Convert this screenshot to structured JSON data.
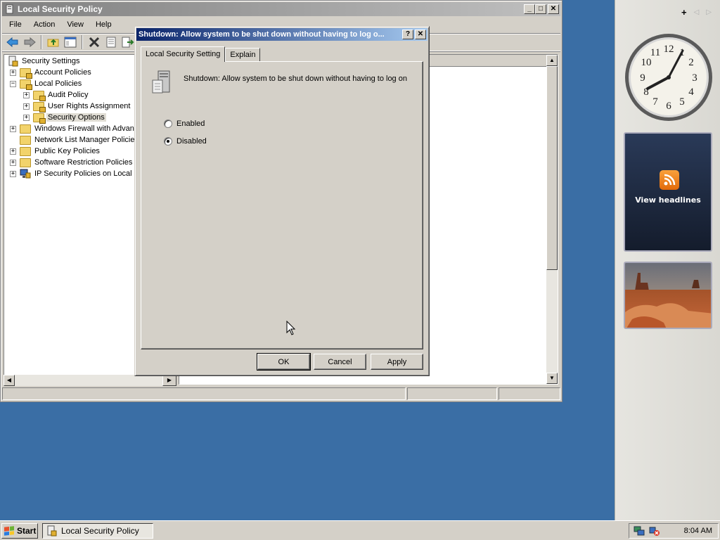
{
  "main_window": {
    "title": "Local Security Policy",
    "caption_buttons": {
      "minimize": "_",
      "maximize": "□",
      "close": "✕"
    },
    "menu": [
      "File",
      "Action",
      "View",
      "Help"
    ],
    "toolbar_icons": [
      "back-icon",
      "forward-icon",
      "up-folder-icon",
      "show-hide-tree-icon",
      "delete-icon",
      "properties-icon",
      "export-list-icon"
    ],
    "tree": {
      "root": "Security Settings",
      "items": [
        {
          "label": "Account Policies",
          "level": 1,
          "expander": "+"
        },
        {
          "label": "Local Policies",
          "level": 1,
          "expander": "−"
        },
        {
          "label": "Audit Policy",
          "level": 2,
          "expander": "+"
        },
        {
          "label": "User Rights Assignment",
          "level": 2,
          "expander": "+"
        },
        {
          "label": "Security Options",
          "level": 2,
          "expander": "+",
          "selected": true
        },
        {
          "label": "Windows Firewall with Advanc",
          "level": 1,
          "expander": "+"
        },
        {
          "label": "Network List Manager Policies",
          "level": 1,
          "expander": ""
        },
        {
          "label": "Public Key Policies",
          "level": 1,
          "expander": "+"
        },
        {
          "label": "Software Restriction Policies",
          "level": 1,
          "expander": "+"
        },
        {
          "label": "IP Security Policies on Local C",
          "level": 1,
          "expander": "+"
        }
      ]
    }
  },
  "dialog": {
    "title": "Shutdown: Allow system to be shut down without having to log o...",
    "help_button": "?",
    "close_button": "✕",
    "tabs": [
      "Local Security Setting",
      "Explain"
    ],
    "active_tab": "Local Security Setting",
    "policy_name": "Shutdown: Allow system to be shut down without having to log on",
    "options": [
      {
        "label": "Enabled",
        "selected": false
      },
      {
        "label": "Disabled",
        "selected": true
      }
    ],
    "buttons": {
      "ok": "OK",
      "cancel": "Cancel",
      "apply": "Apply"
    }
  },
  "sidebar": {
    "add_button": "+",
    "prev": "◁",
    "next": "▷",
    "clock_numbers": [
      "12",
      "1",
      "2",
      "3",
      "4",
      "5",
      "6",
      "7",
      "8",
      "9",
      "10",
      "11"
    ],
    "feed_label": "View headlines",
    "feed_icon": "rss-icon",
    "slideshow_icon": "desert-photo"
  },
  "taskbar": {
    "start_label": "Start",
    "task_label": "Local Security Policy",
    "time": "8:04 AM",
    "tray_icons": [
      "network-icon",
      "volume-muted-icon"
    ]
  },
  "colors": {
    "desktop": "#3a6ea5",
    "window_face": "#d4d0c8",
    "dialog_title_start": "#0a246a",
    "dialog_title_end": "#a6caf0",
    "feed_bg": "#1b2538",
    "rss_orange": "#f08a24"
  }
}
